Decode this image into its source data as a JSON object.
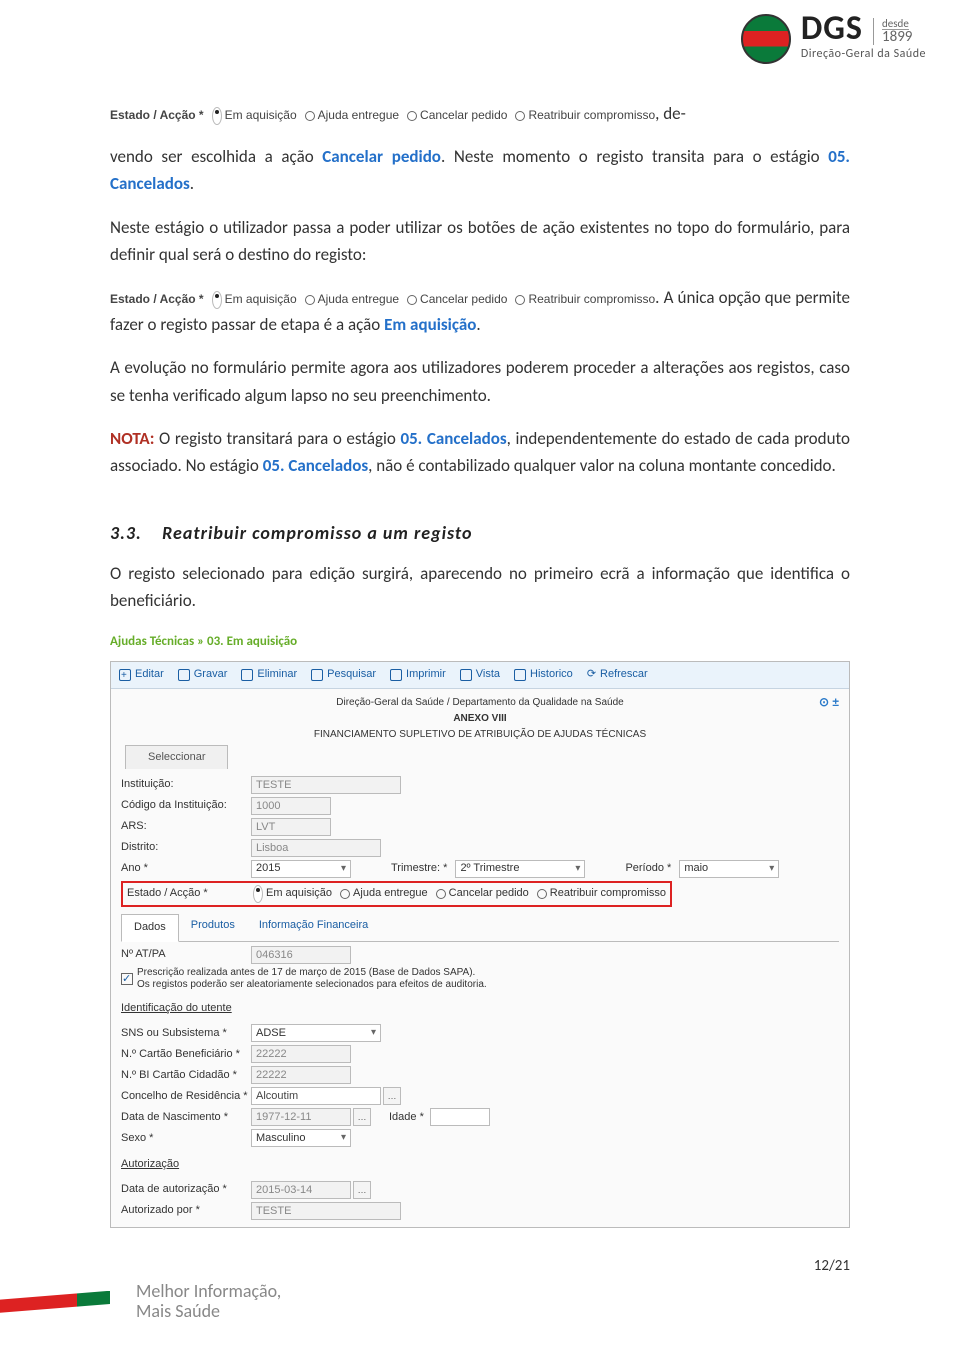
{
  "header": {
    "acronym": "DGS",
    "desde": "desde",
    "year": "1899",
    "subtitle": "Direção-Geral da Saúde"
  },
  "radio_strip": {
    "label": "Estado / Acção *",
    "options": [
      "Em aquisição",
      "Ajuda entregue",
      "Cancelar pedido",
      "Reatribuir compromisso"
    ],
    "selected": "Em aquisição"
  },
  "text": {
    "p1_a": ", de-",
    "p1_b": "vendo ser escolhida a ação ",
    "p1_c": "Cancelar pedido",
    "p1_d": ". Neste momento o registo transita para o estágio ",
    "p1_e": "05. Cancelados",
    "p1_f": ".",
    "p2": "Neste estágio o utilizador passa a poder utilizar os botões de ação existentes no topo do formulário, para definir qual será o destino do registo:",
    "p2_tail_a": ". A única opção que permite fazer o registo passar de etapa é a ação ",
    "p2_tail_b": "Em aquisição",
    "p2_tail_c": ".",
    "p3": "A evolução no formulário permite agora aos utilizadores poderem proceder a alterações aos registos, caso se tenha verificado algum lapso no seu preenchimento.",
    "nota_label": "NOTA:",
    "nota_a": " O registo transitará para o estágio ",
    "nota_b": "05. Cancelados",
    "nota_c": ", independentemente do estado de cada produto associado. No estágio ",
    "nota_d": "05. Cancelados",
    "nota_e": ", não é contabilizado qualquer valor na coluna montante concedido."
  },
  "section": {
    "num": "3.3.",
    "title": "Reatribuir compromisso a um registo",
    "intro": "O registo selecionado para edição surgirá, aparecendo no primeiro ecrã a informação que identifica o beneficiário."
  },
  "app": {
    "breadcrumb": "Ajudas Técnicas » 03. Em aquisição",
    "toolbar": {
      "editar": "Editar",
      "gravar": "Gravar",
      "eliminar": "Eliminar",
      "pesquisar": "Pesquisar",
      "imprimir": "Imprimir",
      "vista": "Vista",
      "historico": "Historico",
      "refrescar": "Refrescar"
    },
    "head1": "Direção-Geral da Saúde / Departamento da Qualidade na Saúde",
    "head2": "ANEXO VIII",
    "head3": "FINANCIAMENTO SUPLETIVO DE ATRIBUIÇÃO DE AJUDAS TÉCNICAS",
    "right_icons": "⊙ ±",
    "sel_tab": "Seleccionar",
    "fields": {
      "instituicao_label": "Instituição:",
      "instituicao_val": "TESTE",
      "codigo_label": "Código da Instituição:",
      "codigo_val": "1000",
      "ars_label": "ARS:",
      "ars_val": "LVT",
      "distrito_label": "Distrito:",
      "distrito_val": "Lisboa",
      "ano_label": "Ano *",
      "ano_val": "2015",
      "trimestre_label": "Trimestre: *",
      "trimestre_val": "2º Trimestre",
      "periodo_label": "Período *",
      "periodo_val": "maio",
      "estado_label": "Estado / Acção *",
      "estado_opts": [
        "Em aquisição",
        "Ajuda entregue",
        "Cancelar pedido",
        "Reatribuir compromisso"
      ],
      "informacao_tab": "Informação Financeira"
    },
    "tabs": {
      "dados": "Dados",
      "produtos": "Produtos",
      "info_fin": "Informação Financeira"
    },
    "dados": {
      "natpa_label": "Nº AT/PA",
      "natpa_val": "046316",
      "presc_line1": "Prescrição realizada antes de 17 de março de 2015 (Base de Dados SAPA).",
      "presc_line2": "Os registos poderão ser aleatoriamente selecionados para efeitos de auditoria.",
      "ident_title": "Identificação do utente",
      "sns_label": "SNS ou Subsistema *",
      "sns_val": "ADSE",
      "cartao_label": "N.º Cartão Beneficiário *",
      "cartao_val": "22222",
      "bi_label": "N.º BI Cartão Cidadão *",
      "bi_val": "22222",
      "concelho_label": "Concelho de Residência *",
      "concelho_val": "Alcoutim",
      "nasc_label": "Data de Nascimento *",
      "nasc_val": "1977-12-11",
      "idade_label": "Idade *",
      "idade_val": "",
      "sexo_label": "Sexo *",
      "sexo_val": "Masculino",
      "aut_title": "Autorização",
      "data_aut_label": "Data de autorização *",
      "data_aut_val": "2015-03-14",
      "aut_por_label": "Autorizado por *",
      "aut_por_val": "TESTE"
    }
  },
  "page_num": "12/21",
  "footer": {
    "line1": "Melhor Informação,",
    "line2": "Mais Saúde"
  }
}
